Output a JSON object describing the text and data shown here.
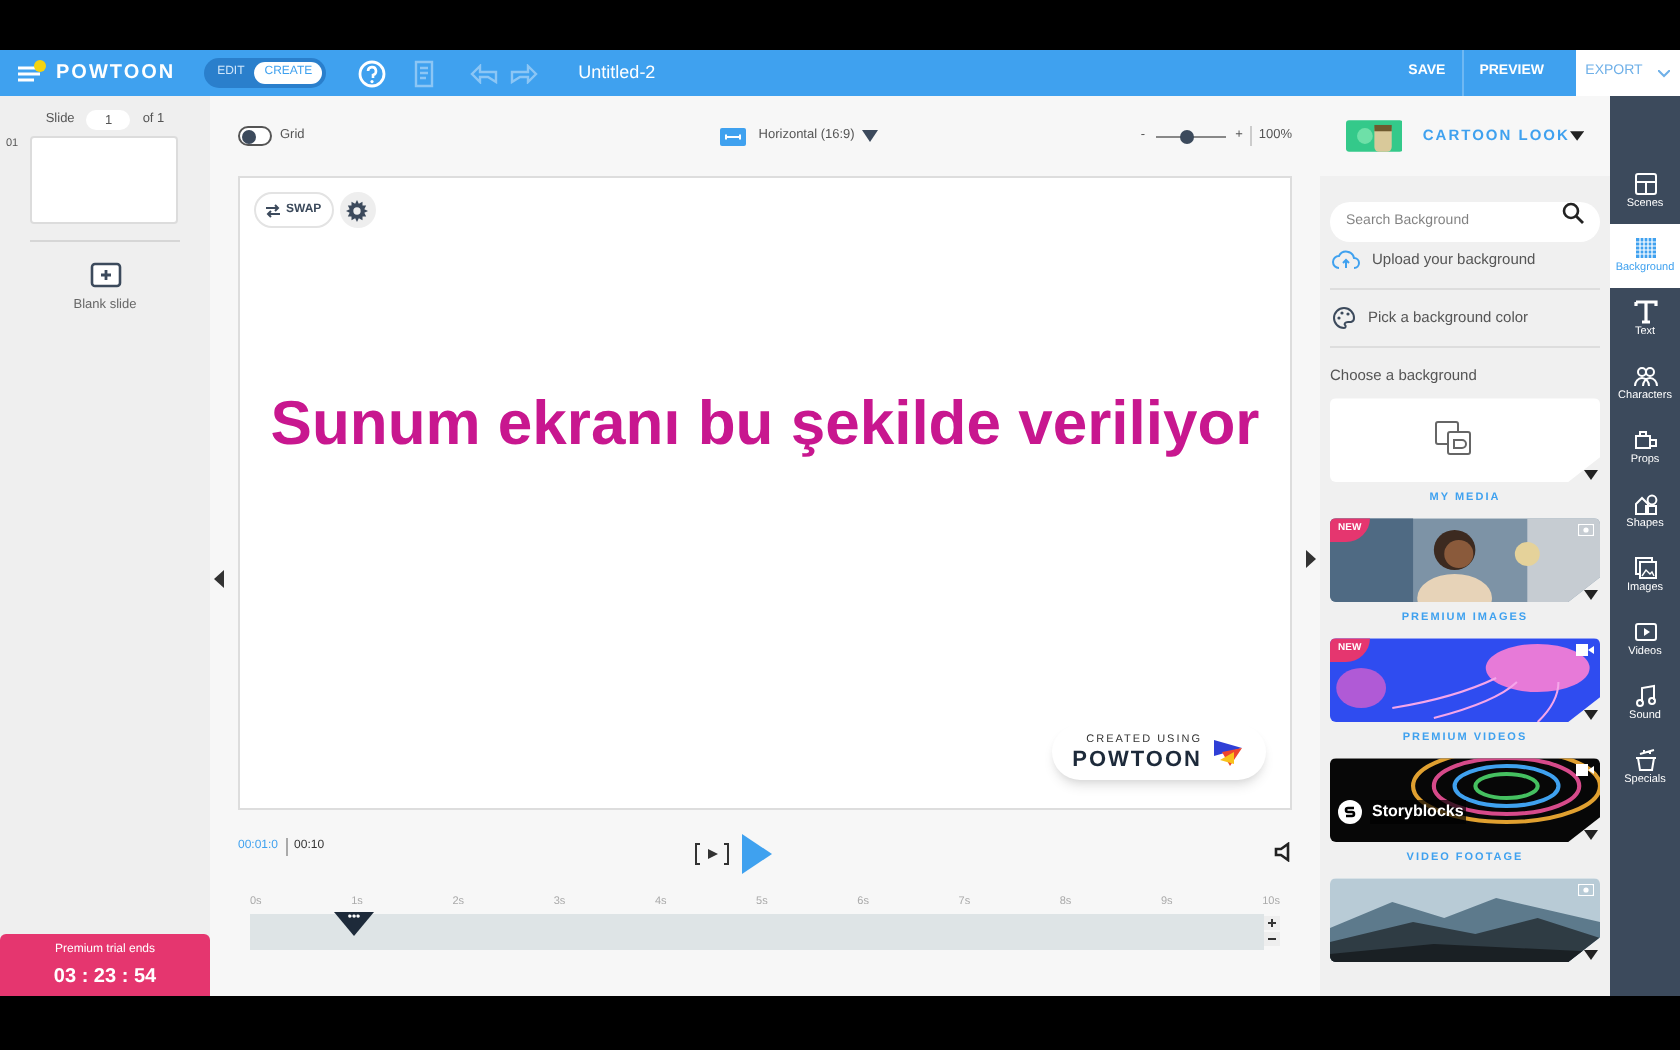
{
  "topbar": {
    "logo": "POWTOON",
    "modes": [
      {
        "label": "EDIT",
        "selected": false
      },
      {
        "label": "CREATE",
        "selected": true
      }
    ],
    "title": "Untitled-2",
    "actions": [
      "SAVE",
      "PREVIEW"
    ],
    "export": "EXPORT"
  },
  "slides_panel": {
    "label": "Slide",
    "current": "1",
    "total": "of 1",
    "slides": [
      {
        "number": "01",
        "selected": true
      }
    ],
    "blank_slide": "Blank slide",
    "trial": {
      "label": "Premium trial ends",
      "countdown": "03 : 23 : 54"
    }
  },
  "canvas_toolbar": {
    "grid": {
      "label": "Grid",
      "on": false
    },
    "orientation": "Horizontal (16:9)",
    "zoom": {
      "minus": "-",
      "plus": "+",
      "level": 0.45,
      "reading": "100%"
    }
  },
  "slide": {
    "swap": "SWAP",
    "caption": "Sunum ekranı bu şekilde veriliyor",
    "badge_small": "CREATED USING",
    "badge_brand": "POWTOON"
  },
  "playback": {
    "current": "00:01:0",
    "total": "00:10",
    "ticks": [
      "0s",
      "1s",
      "2s",
      "3s",
      "4s",
      "5s",
      "6s",
      "7s",
      "8s",
      "9s",
      "10s"
    ],
    "playhead": "•••"
  },
  "style": {
    "label": "CARTOON LOOK"
  },
  "library": {
    "search": {
      "placeholder": "Search Background"
    },
    "options": [
      "Upload your background",
      "Pick a background color"
    ],
    "heading": "Choose a background",
    "cards": [
      {
        "kind": "media",
        "label": "MY MEDIA",
        "new": false
      },
      {
        "label": "PREMIUM IMAGES",
        "new": true,
        "new_label": "NEW"
      },
      {
        "kind": "video",
        "label": "PREMIUM VIDEOS",
        "new": true,
        "new_label": "NEW"
      },
      {
        "kind": "footage",
        "label": "VIDEO FOOTAGE",
        "new": false,
        "brand": "Storyblocks"
      },
      {
        "kind": "landscape",
        "new": false
      }
    ]
  },
  "tools": [
    {
      "label": "Scenes",
      "selected": false
    },
    {
      "label": "Background",
      "selected": true
    },
    {
      "label": "Text",
      "selected": false
    },
    {
      "label": "Characters",
      "selected": false
    },
    {
      "label": "Props",
      "selected": false
    },
    {
      "label": "Shapes",
      "selected": false
    },
    {
      "label": "Images",
      "selected": false
    },
    {
      "label": "Videos",
      "selected": false
    },
    {
      "label": "Sound",
      "selected": false
    },
    {
      "label": "Specials",
      "selected": false
    }
  ]
}
